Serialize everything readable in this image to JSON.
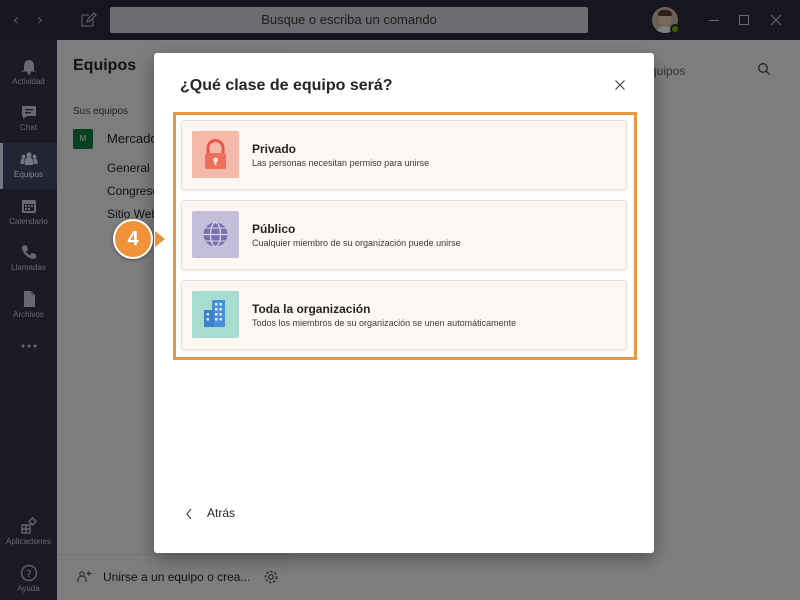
{
  "titlebar": {
    "back_arrow": "‹",
    "forward_arrow": "›",
    "search_placeholder": "Busque o escriba un comando",
    "status_color": "#6bb700"
  },
  "rail": {
    "items": [
      {
        "label": "Actividad",
        "icon": "bell-icon"
      },
      {
        "label": "Chat",
        "icon": "chat-icon"
      },
      {
        "label": "Equipos",
        "icon": "teams-icon",
        "active": true
      },
      {
        "label": "Calendario",
        "icon": "calendar-icon"
      },
      {
        "label": "Llamadas",
        "icon": "phone-icon"
      },
      {
        "label": "Archivos",
        "icon": "file-icon"
      },
      {
        "label": "",
        "icon": "more-icon"
      }
    ],
    "apps_label": "Aplicaciones",
    "help_label": "Ayuda"
  },
  "panel": {
    "title": "Equipos",
    "section_label": "Sus equipos",
    "team_initial": "M",
    "team_name": "Mercadot",
    "channels": [
      "General",
      "Congreso",
      "Sitio Web"
    ],
    "join_label": "Unirse a un equipo o crea..."
  },
  "main": {
    "search_text": "quipos"
  },
  "modal": {
    "title": "¿Qué clase de equipo será?",
    "options": [
      {
        "title": "Privado",
        "description": "Las personas necesitan permiso para unirse",
        "icon": "lock-icon",
        "color": "#f4b9a8"
      },
      {
        "title": "Público",
        "description": "Cualquier miembro de su organización puede unirse",
        "icon": "globe-icon",
        "color": "#c5bedb"
      },
      {
        "title": "Toda la organización",
        "description": "Todos los miembros de su organización se unen automáticamente",
        "icon": "building-icon",
        "color": "#a8dccf"
      }
    ],
    "back_label": "Atrás",
    "highlight_color": "#e8963f"
  },
  "step_badge": "4"
}
